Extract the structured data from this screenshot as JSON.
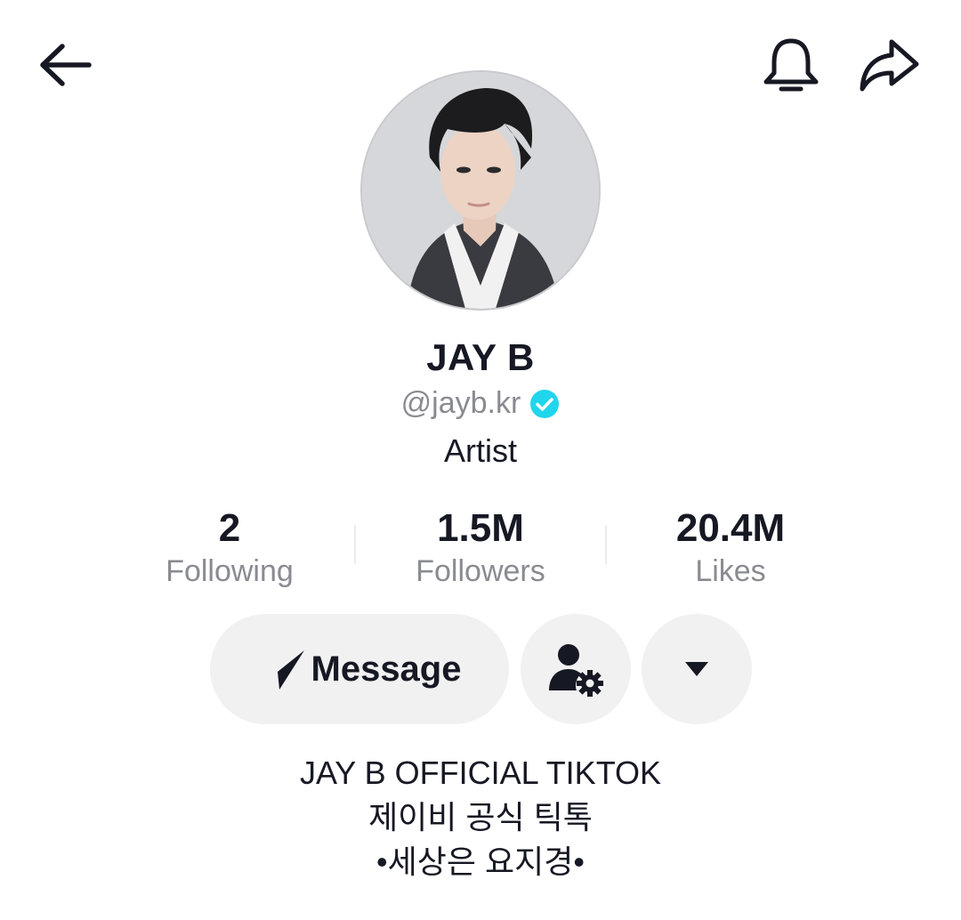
{
  "header": {
    "back_icon": "arrow-left-icon",
    "notification_icon": "bell-icon",
    "share_icon": "share-arrow-icon"
  },
  "profile": {
    "display_name": "JAY B",
    "handle": "@jayb.kr",
    "verified": true,
    "verified_color": "#20d5ec",
    "category": "Artist"
  },
  "stats": [
    {
      "value": "2",
      "label": "Following"
    },
    {
      "value": "1.5M",
      "label": "Followers"
    },
    {
      "value": "20.4M",
      "label": "Likes"
    }
  ],
  "actions": {
    "message_label": "Message",
    "message_icon": "paper-plane-icon",
    "settings_icon": "user-settings-icon",
    "more_icon": "triangle-down-icon"
  },
  "bio": {
    "lines": [
      "JAY B OFFICIAL TIKTOK",
      "제이비 공식 틱톡",
      "•세상은 요지경•"
    ]
  }
}
